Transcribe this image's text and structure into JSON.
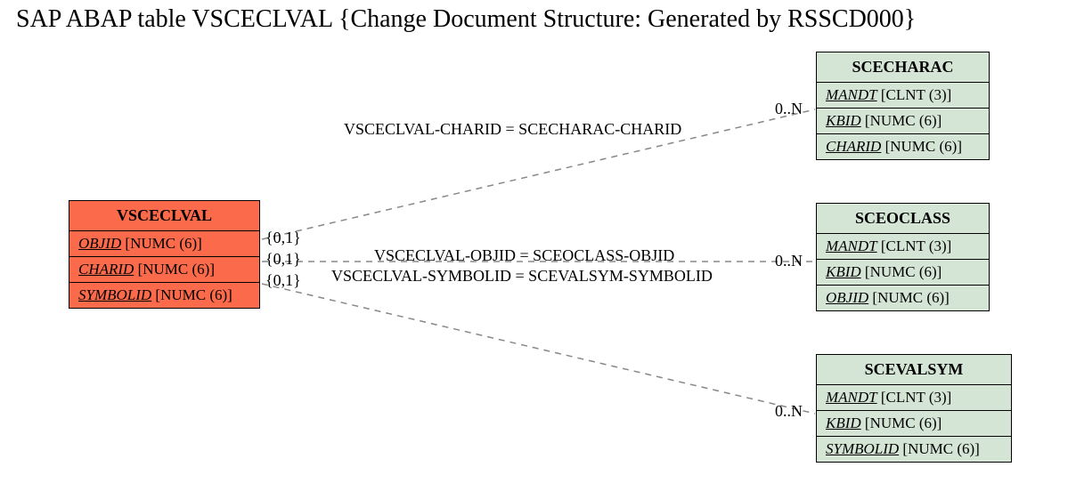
{
  "title": "SAP ABAP table VSCECLVAL {Change Document Structure: Generated by RSSCD000}",
  "tables": {
    "vsceclval": {
      "name": "VSCECLVAL",
      "fields": [
        {
          "field": "OBJID",
          "type": "[NUMC (6)]"
        },
        {
          "field": "CHARID",
          "type": "[NUMC (6)]"
        },
        {
          "field": "SYMBOLID",
          "type": "[NUMC (6)]"
        }
      ]
    },
    "scecharac": {
      "name": "SCECHARAC",
      "fields": [
        {
          "field": "MANDT",
          "type": "[CLNT (3)]"
        },
        {
          "field": "KBID",
          "type": "[NUMC (6)]"
        },
        {
          "field": "CHARID",
          "type": "[NUMC (6)]"
        }
      ]
    },
    "sceoclass": {
      "name": "SCEOCLASS",
      "fields": [
        {
          "field": "MANDT",
          "type": "[CLNT (3)]"
        },
        {
          "field": "KBID",
          "type": "[NUMC (6)]"
        },
        {
          "field": "OBJID",
          "type": "[NUMC (6)]"
        }
      ]
    },
    "scevalsym": {
      "name": "SCEVALSYM",
      "fields": [
        {
          "field": "MANDT",
          "type": "[CLNT (3)]"
        },
        {
          "field": "KBID",
          "type": "[NUMC (6)]"
        },
        {
          "field": "SYMBOLID",
          "type": "[NUMC (6)]"
        }
      ]
    }
  },
  "relations": {
    "r1": {
      "left_card": "{0,1}",
      "label": "VSCECLVAL-CHARID = SCECHARAC-CHARID",
      "right_card": "0..N"
    },
    "r2": {
      "left_card": "{0,1}",
      "label": "VSCECLVAL-OBJID = SCEOCLASS-OBJID",
      "right_card": "0..N"
    },
    "r3": {
      "left_card": "{0,1}",
      "label": "VSCECLVAL-SYMBOLID = SCEVALSYM-SYMBOLID",
      "right_card": "0..N"
    }
  }
}
